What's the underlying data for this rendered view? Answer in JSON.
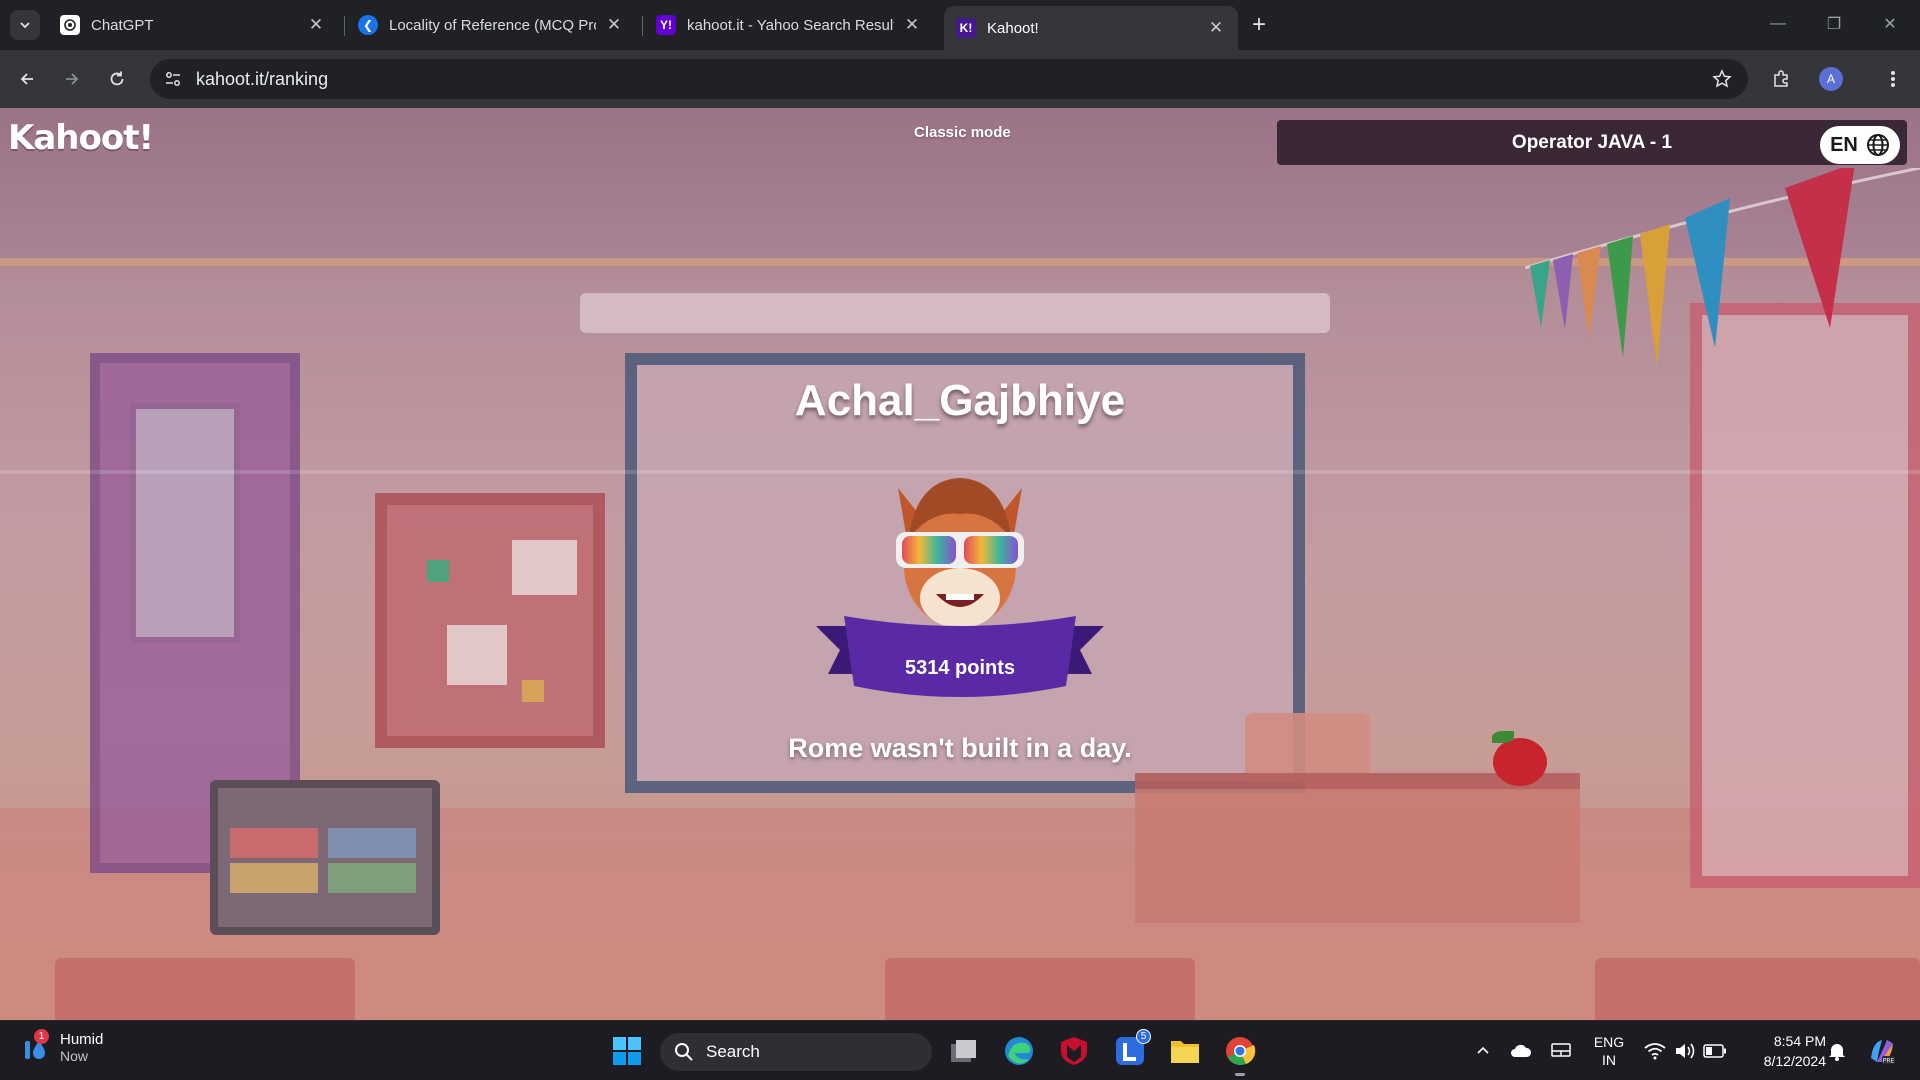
{
  "browser": {
    "tabs": [
      {
        "title": "ChatGPT",
        "icon": "chatgpt-icon",
        "active": false
      },
      {
        "title": "Locality of Reference (MCQ Pro",
        "icon": "blue-logo-icon",
        "active": false
      },
      {
        "title": "kahoot.it - Yahoo Search Result",
        "icon": "yahoo-icon",
        "active": false
      },
      {
        "title": "Kahoot!",
        "icon": "kahoot-icon",
        "active": true
      }
    ],
    "url": "kahoot.it/ranking",
    "profile_initial": "A"
  },
  "page": {
    "logo": "Kahoot!",
    "mode": "Classic mode",
    "quiz_title": "Operator JAVA - 1",
    "language": "EN",
    "player_name": "Achal_Gajbhiye",
    "points": "5314 points",
    "message": "Rome wasn't built in a day."
  },
  "taskbar": {
    "weather_title": "Humid",
    "weather_subtitle": "Now",
    "weather_badge": "1",
    "search_label": "Search",
    "store_badge": "5",
    "lang_line1": "ENG",
    "lang_line2": "IN",
    "time": "8:54 PM",
    "date": "8/12/2024"
  },
  "colors": {
    "kahoot_purple": "#46178f",
    "ribbon_purple": "#5a2aa6",
    "browser_dark": "#202124",
    "taskbar": "#1c1c22"
  }
}
